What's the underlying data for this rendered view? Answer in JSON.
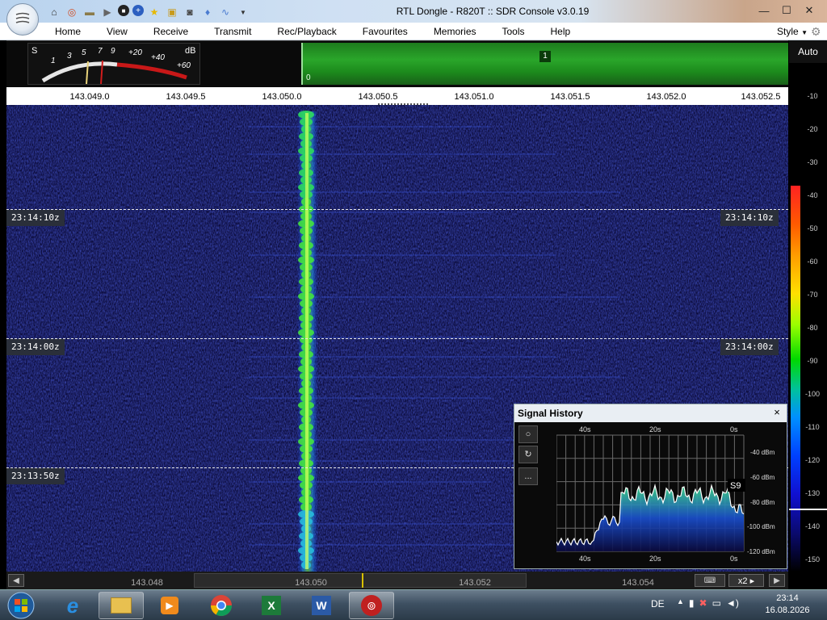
{
  "window": {
    "title": "RTL Dongle - R820T :: SDR Console v3.0.19",
    "controls": [
      "minimize",
      "maximize",
      "close"
    ]
  },
  "quick_access": {
    "icons": [
      "home-icon",
      "lifebuoy-icon",
      "folder-icon",
      "play-icon",
      "stop-icon",
      "plus-icon",
      "star-icon",
      "lock-icon",
      "camera-icon",
      "drop-icon",
      "wave-icon",
      "dropdown-icon"
    ]
  },
  "menu": {
    "items": [
      "Home",
      "View",
      "Receive",
      "Transmit",
      "Rec/Playback",
      "Favourites",
      "Memories",
      "Tools",
      "Help"
    ],
    "style_label": "Style"
  },
  "smeter": {
    "s_label": "S",
    "db_label": "dB",
    "scale": [
      "1",
      "3",
      "5",
      "7",
      "9",
      "+20",
      "+40",
      "+60"
    ]
  },
  "bandwidth": {
    "marker": "1",
    "zero": "0"
  },
  "auto_label": "Auto",
  "frequency_scale": {
    "labels": [
      "143.049.0",
      "143.049.5",
      "143.050.0",
      "143.050.5",
      "143.051.0",
      "143.051.5",
      "143.052.0",
      "143.052.5"
    ]
  },
  "waterfall": {
    "time_markers": [
      "23:14:10z",
      "23:14:00z",
      "23:13:50z"
    ]
  },
  "signal_history": {
    "title": "Signal History",
    "close": "×",
    "buttons": [
      "○",
      "↻",
      "..."
    ],
    "x_labels": [
      "40s",
      "20s",
      "0s"
    ],
    "y_labels": [
      "-40 dBm",
      "-60 dBm",
      "-80 dBm",
      "-100 dBm",
      "-120 dBm"
    ],
    "s_badge": "S9"
  },
  "db_scale": {
    "labels": [
      "-10",
      "-20",
      "-30",
      "-40",
      "-50",
      "-60",
      "-70",
      "-80",
      "-90",
      "-100",
      "-110",
      "-120",
      "-130",
      "-140",
      "-150"
    ]
  },
  "bottom_scroll": {
    "labels": [
      "143.048",
      "143.050",
      "143.052",
      "143.054"
    ],
    "zoom": "x2",
    "keyboard": "⌨"
  },
  "taskbar": {
    "apps": [
      "Internet Explorer",
      "Windows Explorer",
      "Media Player",
      "Chrome",
      "Excel",
      "Word",
      "SDR Console"
    ],
    "language": "DE",
    "time": "23:14",
    "date": "16.08.2026"
  }
}
